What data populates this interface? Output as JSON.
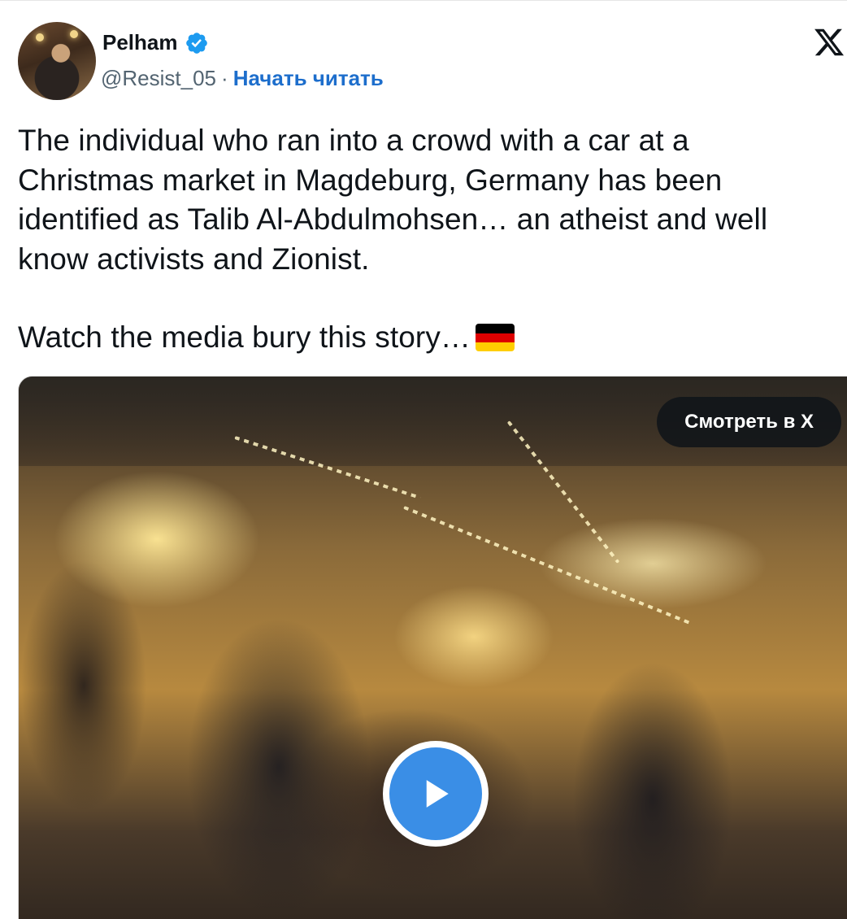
{
  "author": {
    "name": "Pelham",
    "handle": "@Resist_05",
    "separator": "·",
    "follow_label": "Начать читать",
    "verified": true
  },
  "tweet": {
    "text_main": "The individual who ran into a crowd with a car at a Christmas market in Magdeburg, Germany has been identified as Talib Al-Abdulmohsen… an atheist and well know activists and Zionist.",
    "text_second": "Watch the media bury this story…",
    "flag": "germany-flag-emoji"
  },
  "media": {
    "watch_label": "Смотреть в X",
    "play_icon": "play-icon"
  },
  "icons": {
    "platform": "x-logo-icon",
    "verified": "verified-badge-icon"
  },
  "colors": {
    "link": "#1d6ecc",
    "verified": "#1d9bf0",
    "play": "#3a8ee6",
    "text": "#0f1419",
    "muted": "#536471"
  }
}
